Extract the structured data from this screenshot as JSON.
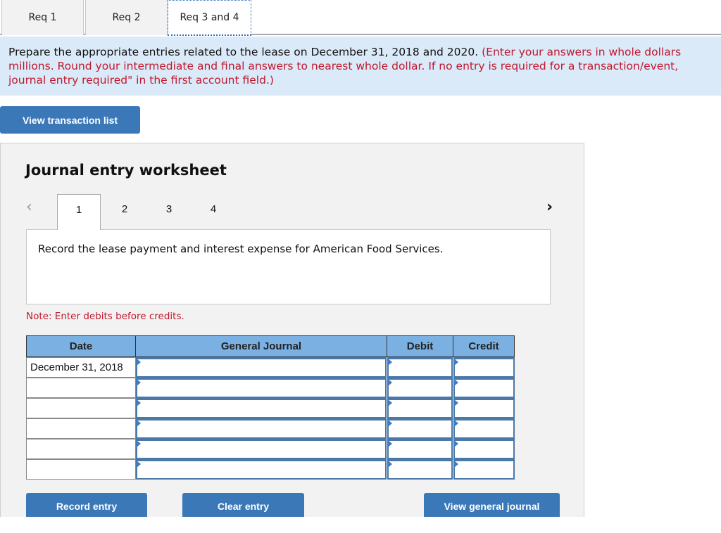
{
  "req_tabs": [
    {
      "label": "Req 1",
      "active": false
    },
    {
      "label": "Req 2",
      "active": false
    },
    {
      "label": "Req 3 and 4",
      "active": true
    }
  ],
  "instructions": {
    "main": "Prepare the appropriate entries related to the lease on December 31, 2018 and 2020.",
    "note_line1": "(Enter your answers in whole dollars",
    "note_line2": "millions. Round your intermediate and final answers to nearest whole dollar. If no entry is required for a transaction/event,",
    "note_line3": "journal entry required\" in the first account field.)"
  },
  "view_transaction_list_label": "View transaction list",
  "worksheet": {
    "title": "Journal entry worksheet",
    "prev_icon": "chevron-left-icon",
    "next_icon": "chevron-right-icon",
    "steps": [
      "1",
      "2",
      "3",
      "4"
    ],
    "active_step": "1",
    "description": "Record the lease payment and interest expense for American Food Services.",
    "note": "Note: Enter debits before credits.",
    "table": {
      "headers": [
        "Date",
        "General Journal",
        "Debit",
        "Credit"
      ],
      "rows": [
        {
          "date": "December 31, 2018",
          "account": "",
          "debit": "",
          "credit": ""
        },
        {
          "date": "",
          "account": "",
          "debit": "",
          "credit": ""
        },
        {
          "date": "",
          "account": "",
          "debit": "",
          "credit": ""
        },
        {
          "date": "",
          "account": "",
          "debit": "",
          "credit": ""
        },
        {
          "date": "",
          "account": "",
          "debit": "",
          "credit": ""
        },
        {
          "date": "",
          "account": "",
          "debit": "",
          "credit": ""
        }
      ]
    },
    "buttons": {
      "record": "Record entry",
      "clear": "Clear entry",
      "view_general_journal": "View general journal"
    }
  },
  "colors": {
    "accent_button": "#3b78b8",
    "instruction_bg": "#dbeaf8",
    "note_red": "#c0182e",
    "table_header": "#7ab0e2"
  }
}
